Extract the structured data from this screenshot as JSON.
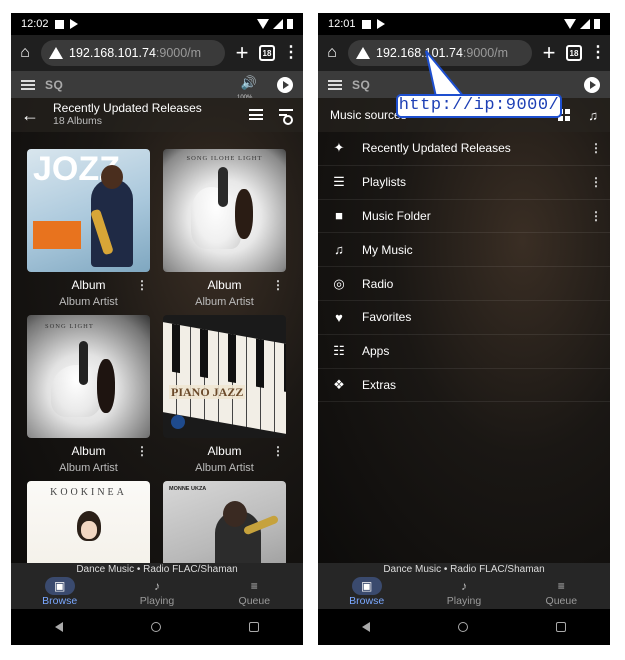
{
  "left": {
    "status": {
      "time": "12:02"
    },
    "browser": {
      "url_host": "192.168.101.74",
      "url_rest": ":9000/m",
      "tab_count": "18"
    },
    "app": {
      "name": "SQ",
      "volume": "100%"
    },
    "subheader": {
      "title": "Recently Updated Releases",
      "count": "18 Albums"
    },
    "albums": [
      {
        "title": "Album",
        "artist": "Album Artist",
        "cover_text": "JOZZ"
      },
      {
        "title": "Album",
        "artist": "Album Artist",
        "cover_text": "SONG ILOHE LIGHT"
      },
      {
        "title": "Album",
        "artist": "Album Artist",
        "cover_text": "SONG LIGHT"
      },
      {
        "title": "Album",
        "artist": "Album Artist",
        "cover_text": "PIANO JAZZ"
      },
      {
        "title": "",
        "artist": "",
        "cover_text": "KOOKINEA"
      },
      {
        "title": "",
        "artist": "",
        "cover_text": "MONNE UKZA"
      }
    ],
    "nowplaying": "Dance Music • Radio FLAC/Shaman",
    "nav": [
      {
        "label": "Browse",
        "icon": "album-icon"
      },
      {
        "label": "Playing",
        "icon": "music-note-icon"
      },
      {
        "label": "Queue",
        "icon": "queue-icon"
      }
    ]
  },
  "right": {
    "status": {
      "time": "12:01"
    },
    "browser": {
      "url_host": "192.168.101.74",
      "url_rest": ":9000/m",
      "tab_count": "18"
    },
    "app": {
      "name": "SQ"
    },
    "callout": "http://ip:9000/",
    "menu_title": "Music sources",
    "menu": [
      {
        "label": "Recently Updated Releases",
        "icon": "new-releases-icon",
        "glyph": "✦",
        "has_menu": true
      },
      {
        "label": "Playlists",
        "icon": "playlist-icon",
        "glyph": "☰",
        "has_menu": true
      },
      {
        "label": "Music Folder",
        "icon": "folder-icon",
        "glyph": "■",
        "has_menu": true
      },
      {
        "label": "My Music",
        "icon": "library-music-icon",
        "glyph": "♫",
        "has_menu": false
      },
      {
        "label": "Radio",
        "icon": "radio-icon",
        "glyph": "◎",
        "has_menu": false
      },
      {
        "label": "Favorites",
        "icon": "heart-icon",
        "glyph": "♥",
        "has_menu": false
      },
      {
        "label": "Apps",
        "icon": "apps-grid-icon",
        "glyph": "☷",
        "has_menu": false
      },
      {
        "label": "Extras",
        "icon": "puzzle-icon",
        "glyph": "❖",
        "has_menu": false
      }
    ],
    "nowplaying": "Dance Music • Radio FLAC/Shaman",
    "nav": [
      {
        "label": "Browse",
        "icon": "album-icon"
      },
      {
        "label": "Playing",
        "icon": "music-note-icon"
      },
      {
        "label": "Queue",
        "icon": "queue-icon"
      }
    ]
  }
}
